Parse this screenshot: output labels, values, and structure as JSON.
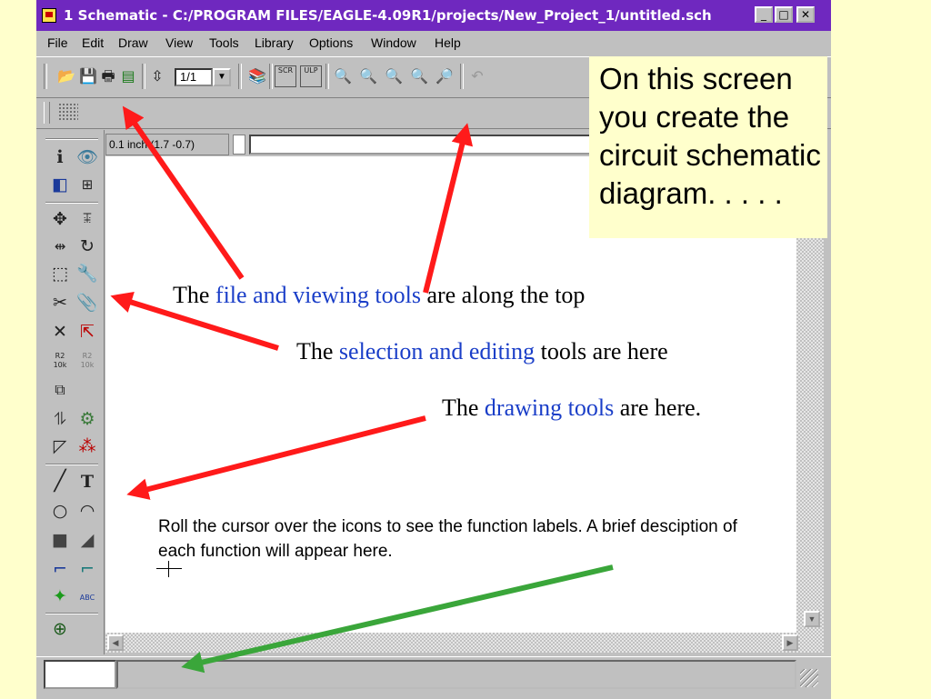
{
  "window": {
    "title": "1 Schematic - C:/PROGRAM FILES/EAGLE-4.09R1/projects/New_Project_1/untitled.sch",
    "minimize_glyph": "_",
    "maximize_glyph": "□",
    "close_glyph": "✕"
  },
  "menu": [
    "File",
    "Edit",
    "Draw",
    "View",
    "Tools",
    "Library",
    "Options",
    "Window",
    "Help"
  ],
  "toolbar": {
    "page_value": "1/1",
    "script_label": "SCR",
    "ulp_label": "ULP"
  },
  "coordinates": "0.1 inch (1.7 -0.7)",
  "palette_tool_labels": {
    "info": "i",
    "text": "T",
    "value_r2": "R2",
    "value_10k": "10k",
    "abc": "ABC"
  },
  "annotations": {
    "callout": "On this screen you create the circuit schematic diagram. . . . .",
    "file_tools": {
      "pre": "The ",
      "highlight": "file and viewing tools",
      "post": " are along the top"
    },
    "selection_tools": {
      "pre": "The ",
      "highlight": "selection and editing",
      "post": " tools are here"
    },
    "drawing_tools": {
      "pre": "The ",
      "highlight": "drawing tools",
      "post": " are here."
    },
    "hint": "Roll the cursor over the icons to see the function labels. A brief desciption of each function will appear here."
  },
  "colors": {
    "slide_background": "#ffffcc",
    "titlebar": "#6f28bf",
    "highlight_text": "#1a3ec8",
    "arrow_red": "#ff1a1a",
    "arrow_green": "#3aa63a"
  }
}
